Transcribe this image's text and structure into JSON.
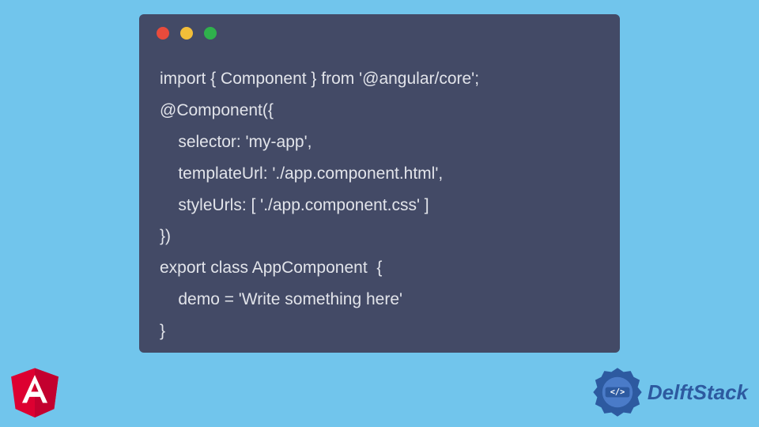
{
  "code": {
    "lines": [
      "import { Component } from '@angular/core';",
      "@Component({",
      "    selector: 'my-app',",
      "    templateUrl: './app.component.html',",
      "    styleUrls: [ './app.component.css' ]",
      "})",
      "export class AppComponent  {",
      "    demo = 'Write something here'",
      "}"
    ]
  },
  "angular_logo_letter": "A",
  "brand": {
    "name": "DelftStack",
    "badge_glyph": "</>"
  },
  "window": {
    "dots": [
      "red",
      "yellow",
      "green"
    ]
  }
}
